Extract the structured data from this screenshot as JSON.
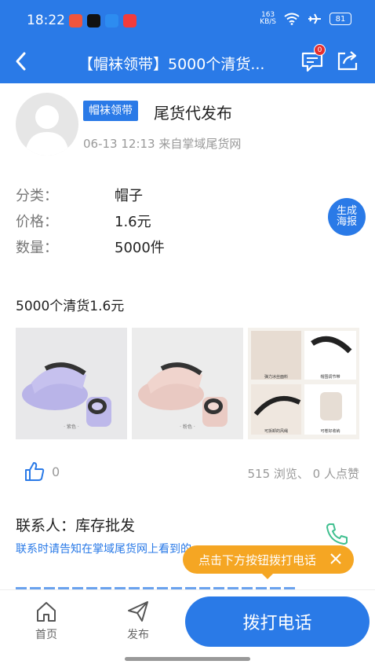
{
  "status_bar": {
    "time": "18:22",
    "network_speed_value": "163",
    "network_speed_unit": "KB/S",
    "battery": "81",
    "app_icons": [
      "#f0553c",
      "#111111",
      "#2d8cf0",
      "#f23c3c"
    ]
  },
  "nav": {
    "title": "【帽袜领带】5000个清货...",
    "message_count": "0"
  },
  "post": {
    "tag": "帽袜领带",
    "title": "尾货代发布",
    "meta": "06-13 12:13  来自掌域尾货网"
  },
  "info": [
    {
      "key": "分类：",
      "value": "帽子"
    },
    {
      "key": "价格：",
      "value": "1.6元"
    },
    {
      "key": "数量：",
      "value": "5000件"
    }
  ],
  "poster_button": "生成\n海报",
  "description": "5000个清货1.6元",
  "photos": {
    "p1_caption": "· 紫色 ·",
    "p2_caption": "· 粉色 ·",
    "p3_labels": [
      "弹力冰丝面料",
      "帽围调节带",
      "可拆卸的风绳",
      "可卷好收纳"
    ]
  },
  "likes": {
    "count": "0",
    "stats": "515 浏览、 0 人点赞"
  },
  "contact": {
    "label": "联系人：库存批发",
    "tip": "联系时请告知在掌域尾货网上看到的"
  },
  "toast": {
    "text": "点击下方按钮拨打电话"
  },
  "bottom": {
    "home": "首页",
    "post": "发布",
    "call": "拨打电话"
  },
  "colors": {
    "primary": "#2a7ae7",
    "toast": "#f5a623",
    "badge": "#e62e2e"
  }
}
